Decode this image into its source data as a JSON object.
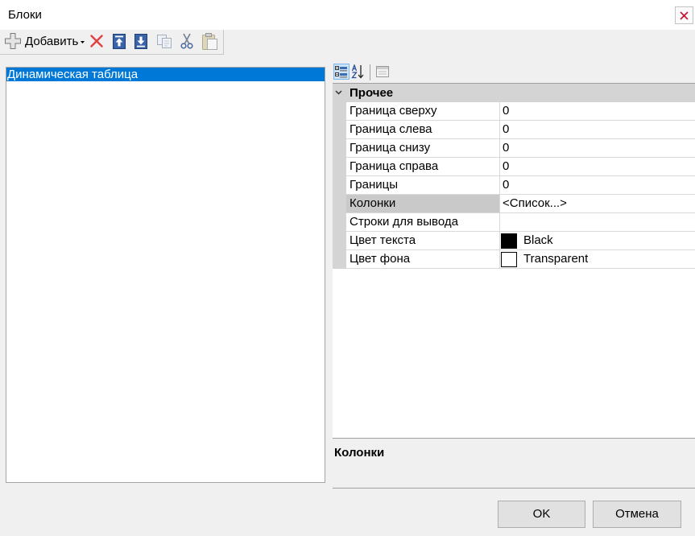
{
  "window": {
    "title": "Блоки",
    "close_icon": "close-icon"
  },
  "toolbar": {
    "add_label": "Добавить",
    "icons": [
      "plus-icon",
      "dropdown-arrow-icon",
      "delete-icon",
      "move-up-icon",
      "move-down-icon",
      "copy-icon",
      "scissors-icon",
      "paste-icon"
    ]
  },
  "blocks": {
    "items": [
      {
        "label": "Динамическая таблица",
        "selected": true
      }
    ]
  },
  "property_toolbar": {
    "icons": [
      "categorized-view-icon",
      "sort-alphabetical-icon",
      "property-pages-icon"
    ],
    "active": "categorized-view-icon"
  },
  "property_grid": {
    "category": "Прочее",
    "expanded": true,
    "rows": [
      {
        "name": "Граница сверху",
        "value": "0"
      },
      {
        "name": "Граница слева",
        "value": "0"
      },
      {
        "name": "Граница снизу",
        "value": "0"
      },
      {
        "name": "Граница справа",
        "value": "0"
      },
      {
        "name": "Границы",
        "value": "0"
      },
      {
        "name": "Колонки",
        "value": "<Список...>",
        "selected": true
      },
      {
        "name": "Строки для вывода",
        "value": ""
      },
      {
        "name": "Цвет текста",
        "value": "Black",
        "swatch": "#000000"
      },
      {
        "name": "Цвет фона",
        "value": "Transparent",
        "swatch": "#ffffff"
      }
    ]
  },
  "help": {
    "title": "Колонки"
  },
  "buttons": {
    "ok": "OK",
    "cancel": "Отмена"
  },
  "colors": {
    "selection": "#0078d7",
    "delete": "#e04343",
    "close": "#c8102e"
  }
}
